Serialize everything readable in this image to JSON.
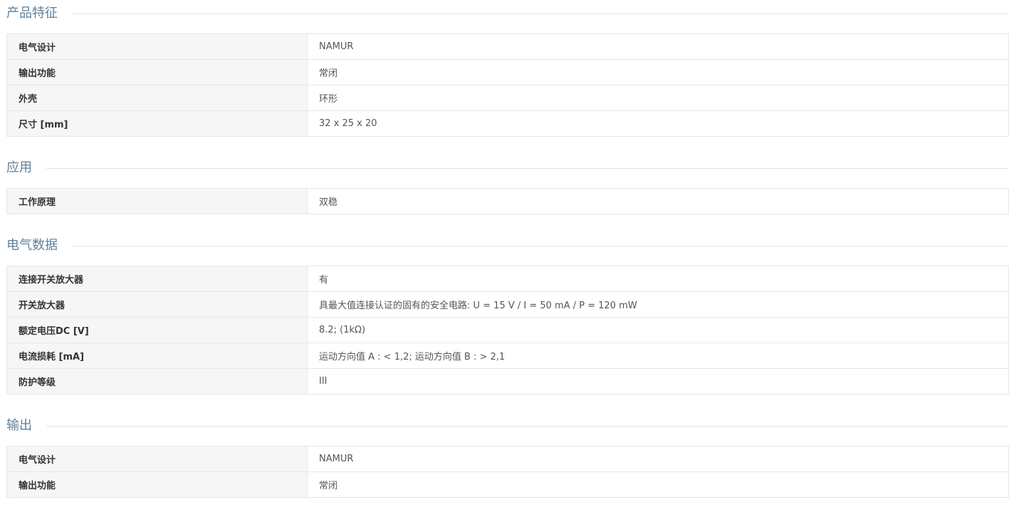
{
  "sections": [
    {
      "title": "产品特征",
      "rows": [
        {
          "label": "电气设计",
          "value": "NAMUR"
        },
        {
          "label": "输出功能",
          "value": "常闭"
        },
        {
          "label": "外壳",
          "value": "环形"
        },
        {
          "label": "尺寸 [mm]",
          "value": "32 x 25 x 20"
        }
      ]
    },
    {
      "title": "应用",
      "rows": [
        {
          "label": "工作原理",
          "value": "双稳"
        }
      ]
    },
    {
      "title": "电气数据",
      "rows": [
        {
          "label": "连接开关放大器",
          "value": "有"
        },
        {
          "label": "开关放大器",
          "value": "具最大值连接认证的固有的安全电路: U = 15 V / I = 50 mA / P = 120 mW"
        },
        {
          "label": "额定电压DC [V]",
          "value": "8.2; (1kΩ)"
        },
        {
          "label": "电流损耗 [mA]",
          "value": "运动方向值 A : < 1,2; 运动方向值 B : > 2,1"
        },
        {
          "label": "防护等级",
          "value": "III"
        }
      ]
    },
    {
      "title": "输出",
      "rows": [
        {
          "label": "电气设计",
          "value": "NAMUR"
        },
        {
          "label": "输出功能",
          "value": "常闭"
        }
      ]
    }
  ],
  "colors": {
    "section_title": "#5f7f9c",
    "label_background": "#f6f6f6",
    "border": "#e6e6e6"
  }
}
